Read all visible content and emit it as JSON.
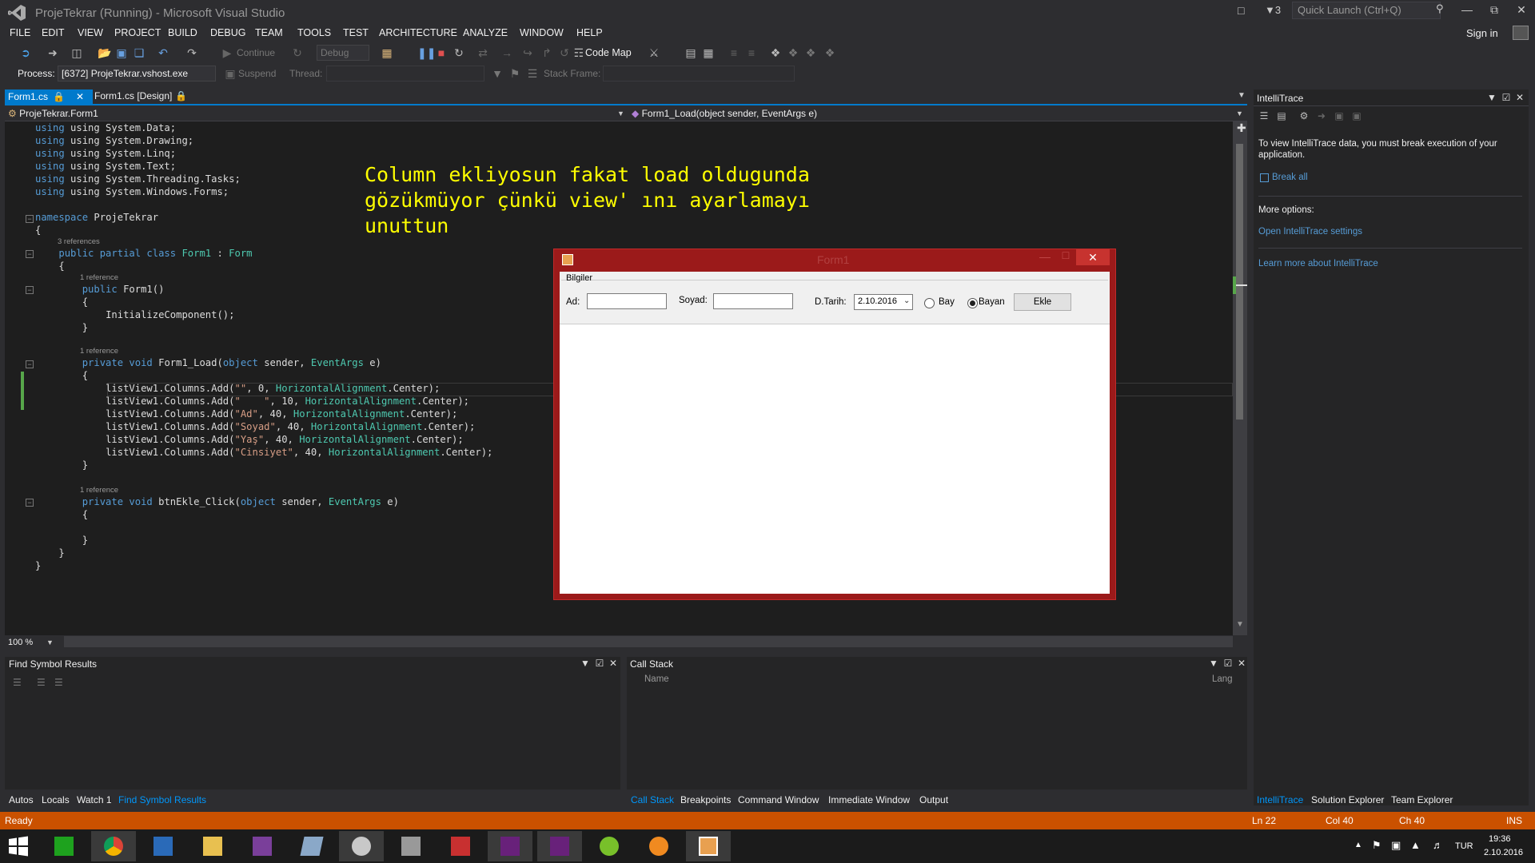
{
  "window": {
    "title": "ProjeTekrar (Running) - Microsoft Visual Studio",
    "filter_count": "3",
    "quick_launch_placeholder": "Quick Launch (Ctrl+Q)",
    "sign_in": "Sign in"
  },
  "menu": [
    "FILE",
    "EDIT",
    "VIEW",
    "PROJECT",
    "BUILD",
    "DEBUG",
    "TEAM",
    "TOOLS",
    "TEST",
    "ARCHITECTURE",
    "ANALYZE",
    "WINDOW",
    "HELP"
  ],
  "toolbar": {
    "continue": "Continue",
    "config": "Debug",
    "code_map": "Code Map"
  },
  "process_bar": {
    "process_label": "Process:",
    "process_value": "[6372] ProjeTekrar.vshost.exe",
    "suspend": "Suspend",
    "thread_label": "Thread:",
    "stack_frame_label": "Stack Frame:"
  },
  "tabs": [
    "Form1.cs",
    "Form1.cs [Design]"
  ],
  "nav": {
    "left": "ProjeTekrar.Form1",
    "right": "Form1_Load(object sender, EventArgs e)"
  },
  "code": {
    "using1": "using System.Data;",
    "using2": "using System.Drawing;",
    "using3": "using System.Linq;",
    "using4": "using System.Text;",
    "using5": "using System.Threading.Tasks;",
    "using6": "using System.Windows.Forms;",
    "ns": "ProjeTekrar",
    "class_refs": "3 references",
    "class_name": "Form1",
    "base": "Form",
    "ctor_refs": "1 reference",
    "ctor_name": "Form1()",
    "init": "InitializeComponent();",
    "load_refs": "1 reference",
    "load_name": "Form1_Load(",
    "btn_refs": "1 reference",
    "btn_name": "btnEkle_Click(",
    "param_sender": " sender, ",
    "param_e": " e)",
    "obj_kw": "object",
    "eventargs": "EventArgs",
    "columns": [
      {
        "text": "\"\"",
        "rest": ", 0, "
      },
      {
        "text": "\"    \"",
        "rest": ", 10, "
      },
      {
        "text": "\"Ad\"",
        "rest": ", 40, "
      },
      {
        "text": "\"Soyad\"",
        "rest": ", 40, "
      },
      {
        "text": "\"Yaş\"",
        "rest": ", 40, "
      },
      {
        "text": "\"Cinsiyet\"",
        "rest": ", 40, "
      }
    ],
    "col_prefix": "listView1.Columns.Add(",
    "col_enum": "HorizontalAlignment",
    "col_suffix": ".Center);"
  },
  "annotation": "Column ekliyosun fakat load oldugunda\ngözükmüyor çünkü view' ını ayarlamayı\nunuttun",
  "zoom": "100 %",
  "form": {
    "title": "Form1",
    "group": "Bilgiler",
    "ad_label": "Ad:",
    "soyad_label": "Soyad:",
    "dtarih_label": "D.Tarih:",
    "dtarih_value": "2.10.2016",
    "bay": "Bay",
    "bayan": "Bayan",
    "selected_gender": "Bayan",
    "ekle": "Ekle"
  },
  "intellitrace": {
    "title": "IntelliTrace",
    "message": "To view IntelliTrace data, you must break execution of your application.",
    "break_all": "Break all",
    "more_options": "More options:",
    "settings_link": "Open IntelliTrace settings",
    "learn_link": "Learn more about IntelliTrace"
  },
  "panels": {
    "find_symbol": "Find Symbol Results",
    "call_stack": "Call Stack",
    "cs_name": "Name",
    "cs_lang": "Lang"
  },
  "bottom_tabs_left": [
    "Autos",
    "Locals",
    "Watch 1",
    "Find Symbol Results"
  ],
  "bottom_tabs_mid": [
    "Call Stack",
    "Breakpoints",
    "Command Window",
    "Immediate Window",
    "Output"
  ],
  "bottom_tabs_right": [
    "IntelliTrace",
    "Solution Explorer",
    "Team Explorer"
  ],
  "status": {
    "ready": "Ready",
    "ln": "Ln 22",
    "col": "Col 40",
    "ch": "Ch 40",
    "ins": "INS"
  },
  "taskbar": {
    "lang": "TUR",
    "time": "19:36",
    "date": "2.10.2016"
  },
  "colors": {
    "status_bar": "#ca5100",
    "accent": "#007acc",
    "annotation": "#ffff00",
    "form_border": "#9b1a1a"
  }
}
